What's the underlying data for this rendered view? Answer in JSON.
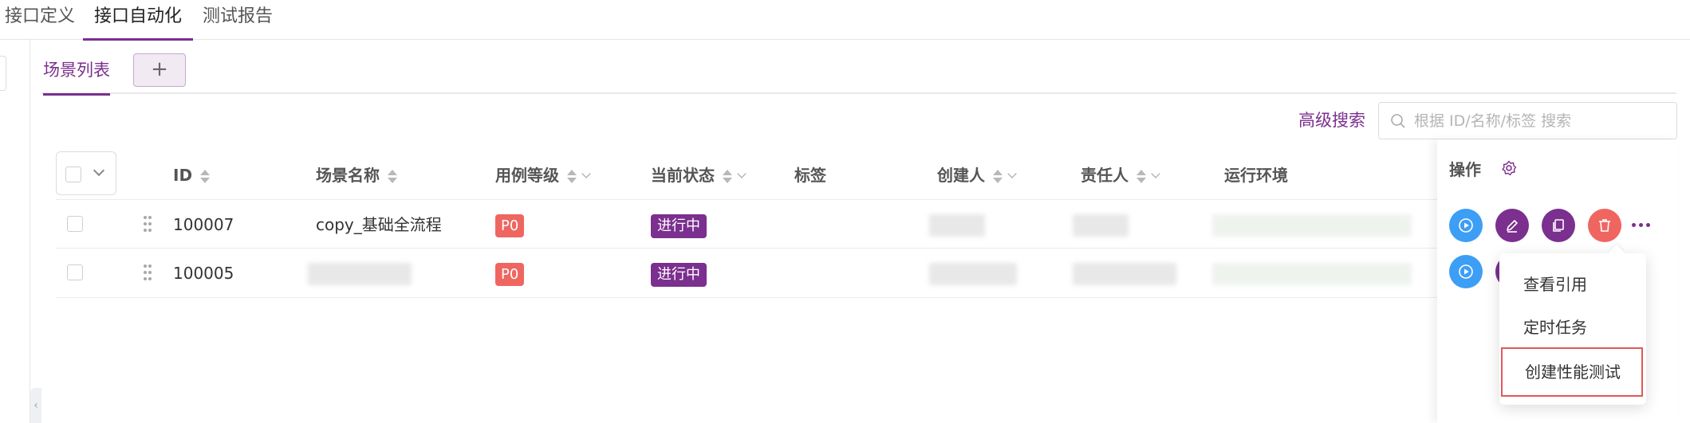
{
  "top_tabs": [
    "接口定义",
    "接口自动化",
    "测试报告"
  ],
  "active_top_tab": "接口自动化",
  "scene_tabs": {
    "list_label": "场景列表",
    "add_label": "+"
  },
  "search": {
    "advanced_label": "高级搜索",
    "placeholder": "根据 ID/名称/标签 搜索"
  },
  "table": {
    "columns": [
      "ID",
      "场景名称",
      "用例等级",
      "当前状态",
      "标签",
      "创建人",
      "责任人",
      "运行环境",
      "操作"
    ],
    "rows": [
      {
        "id": "100007",
        "name": "copy_基础全流程",
        "level": "P0",
        "status": "进行中"
      },
      {
        "id": "100005",
        "name": "",
        "level": "P0",
        "status": "进行中"
      }
    ]
  },
  "more_menu": {
    "items": [
      "查看引用",
      "定时任务",
      "创建性能测试"
    ],
    "highlighted": "创建性能测试"
  },
  "colors": {
    "brand": "#7b2f8e",
    "run_button": "#3d9ef5",
    "delete_button": "#ef6660",
    "p0_badge": "#ef6660"
  },
  "icons": [
    "search-icon",
    "gear-icon",
    "play-icon",
    "edit-icon",
    "copy-icon",
    "trash-icon",
    "more-icon",
    "drag-handle-icon",
    "chevron-down-icon"
  ]
}
